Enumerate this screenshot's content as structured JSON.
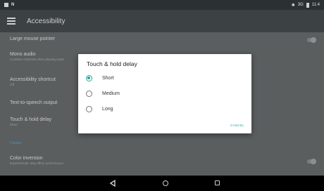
{
  "status_bar": {
    "signal": "3G",
    "time": "11:4"
  },
  "app_bar": {
    "title": "Accessibility"
  },
  "settings": {
    "large_mouse_pointer": "Large mouse pointer",
    "mono_audio": {
      "title": "Mono audio",
      "subtitle": "Combine channels when playing audio"
    },
    "accessibility_shortcut": {
      "title": "Accessibility shortcut",
      "subtitle": "Off"
    },
    "tts_output": "Text-to-speech output",
    "touch_hold_delay": {
      "title": "Touch & hold delay",
      "subtitle": "Short"
    },
    "section_display": "Display",
    "color_inversion": {
      "title": "Color inversion",
      "subtitle": "Experimental: May affect performance"
    }
  },
  "dialog": {
    "title": "Touch & hold delay",
    "options": [
      "Short",
      "Medium",
      "Long"
    ],
    "selected": "Short",
    "cancel_label": "CANCEL"
  },
  "colors": {
    "accent": "#26a69a",
    "scrim": "#5a5e5f",
    "app_bar": "#3c4144"
  }
}
